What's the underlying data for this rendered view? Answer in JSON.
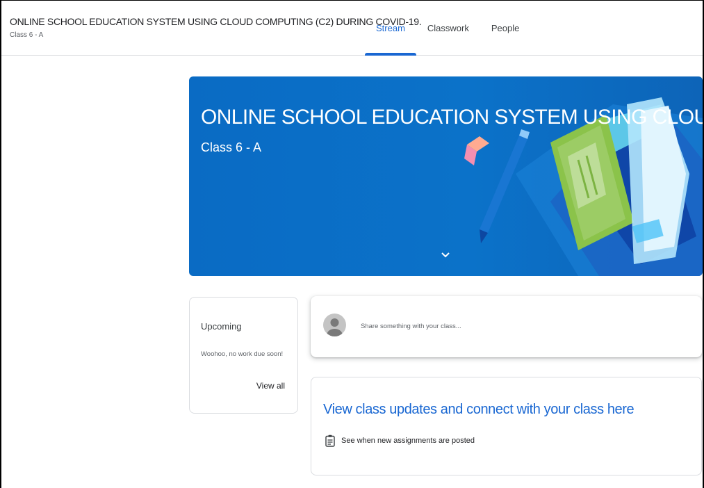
{
  "header": {
    "course_title": "ONLINE SCHOOL EDUCATION SYSTEM USING CLOUD COMPUTING (C2) DURING COVID-19.",
    "course_section": "Class 6 - A",
    "tabs": [
      {
        "label": "Stream",
        "active": true
      },
      {
        "label": "Classwork",
        "active": false
      },
      {
        "label": "People",
        "active": false
      }
    ]
  },
  "banner": {
    "title": "ONLINE SCHOOL EDUCATION SYSTEM USING CLOUD ...",
    "subtitle": "Class 6 - A",
    "background_color": "#0b72c9",
    "expand_icon": "chevron-down-icon"
  },
  "upcoming": {
    "title": "Upcoming",
    "empty_message": "Woohoo, no work due soon!",
    "view_all_label": "View all"
  },
  "share": {
    "placeholder": "Share something with your class...",
    "avatar_icon": "default-avatar-icon"
  },
  "info": {
    "heading": "View class updates and connect with your class here",
    "item_text": "See when new assignments are posted",
    "item_icon": "assignment-icon"
  },
  "colors": {
    "accent": "#1967d2",
    "banner": "#0b72c9"
  }
}
